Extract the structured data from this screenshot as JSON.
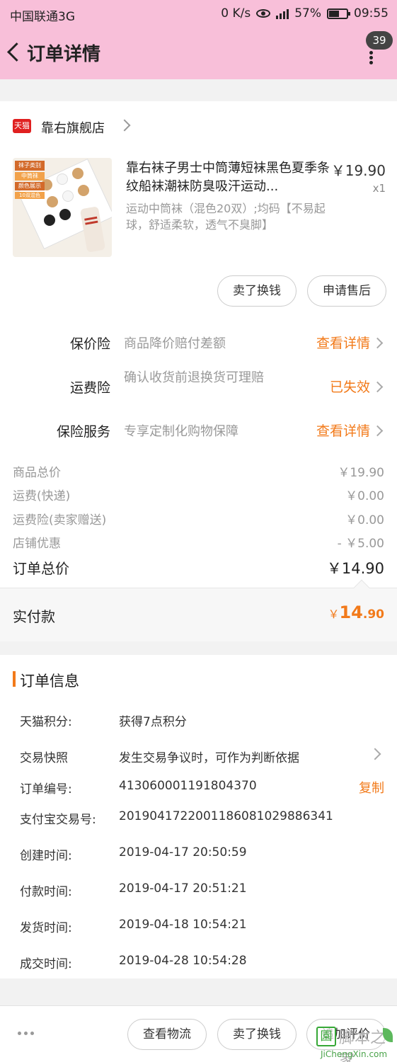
{
  "status_bar": {
    "carrier": "中国联通3G",
    "speed": "0 K/s",
    "network": "4G",
    "battery": "57%",
    "time": "09:55"
  },
  "header": {
    "title": "订单详情",
    "badge": "39"
  },
  "store": {
    "tag": "天猫",
    "name": "靠右旗舰店"
  },
  "product": {
    "thumb_tags": [
      "袜子类别",
      "中筒袜",
      "颜色展示",
      "10双混色"
    ],
    "title": "靠右袜子男士中筒薄短袜黑色夏季条纹船袜潮袜防臭吸汗运动...",
    "price": "￥19.90",
    "qty": "x1",
    "spec": "运动中筒袜（混色20双）;均码【不易起球，舒适柔软，透气不臭脚】",
    "actions": [
      "卖了换钱",
      "申请售后"
    ]
  },
  "insurance": [
    {
      "label": "保价险",
      "desc": "商品降价赔付差额",
      "link": "查看详情"
    },
    {
      "label": "运费险",
      "desc": "确认收货前退换货可理赔",
      "link": "已失效"
    },
    {
      "label": "保险服务",
      "desc": "专享定制化购物保障",
      "link": "查看详情"
    }
  ],
  "fees": [
    {
      "label": "商品总价",
      "value": "￥19.90"
    },
    {
      "label": "运费(快递)",
      "value": "￥0.00"
    },
    {
      "label": "运费险(卖家赠送)",
      "value": "￥0.00"
    },
    {
      "label": "店铺优惠",
      "value": "- ￥5.00"
    }
  ],
  "total": {
    "label": "订单总价",
    "value": "￥14.90"
  },
  "paid": {
    "label": "实付款",
    "currency": "￥",
    "integer": "14",
    "decimal": ".90"
  },
  "order_info": {
    "title": "订单信息",
    "rows": [
      {
        "label": "天猫积分:",
        "value": "获得7点积分"
      },
      {
        "label": "交易快照",
        "value": "发生交易争议时，可作为判断依据"
      },
      {
        "label": "订单编号:",
        "value": "413060001191804370"
      },
      {
        "label": "支付宝交易号:",
        "value": "2019041722001186081029886341"
      },
      {
        "label": "创建时间:",
        "value": "2019-04-17 20:50:59"
      },
      {
        "label": "付款时间:",
        "value": "2019-04-17 20:51:21"
      },
      {
        "label": "发货时间:",
        "value": "2019-04-18 10:54:21"
      },
      {
        "label": "成交时间:",
        "value": "2019-04-28 10:54:28"
      }
    ],
    "copy": "复制"
  },
  "bottom_bar": {
    "buttons": [
      "查看物流",
      "卖了换钱",
      "追加评价"
    ]
  },
  "watermark": {
    "logo": "🏪",
    "text": "脚本之家",
    "url": "JiChengXin.com"
  },
  "colors": {
    "header_bg": "#f8bfd9",
    "accent": "#f27a1a",
    "tmall_red": "#e02020"
  }
}
